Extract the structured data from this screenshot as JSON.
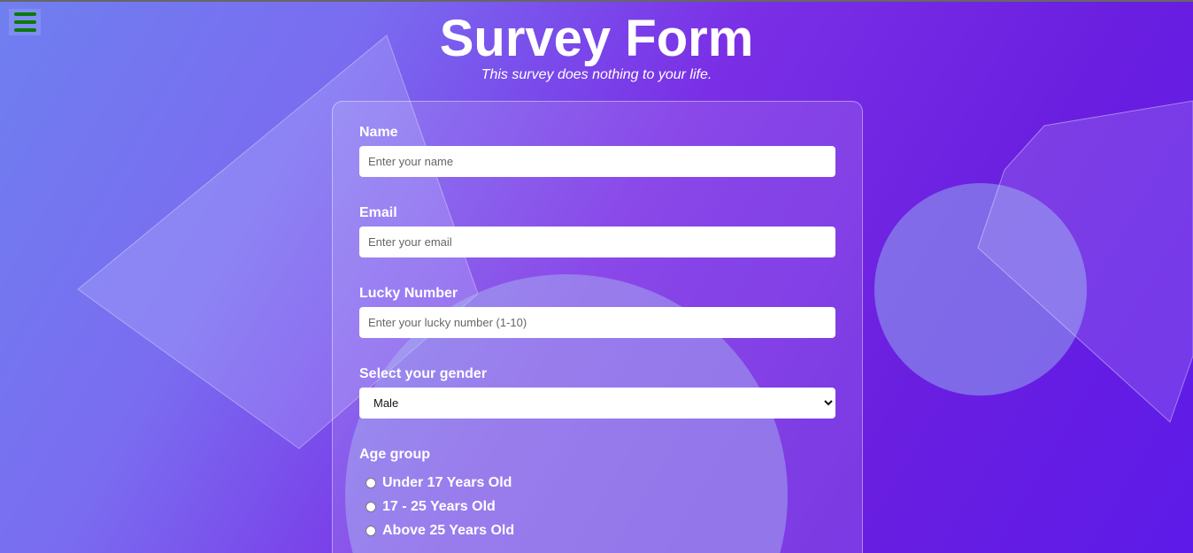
{
  "header": {
    "title": "Survey Form",
    "subtitle": "This survey does nothing to your life."
  },
  "menu": {
    "icon": "hamburger-icon",
    "color": "#0a7a0a"
  },
  "form": {
    "name": {
      "label": "Name",
      "placeholder": "Enter your name"
    },
    "email": {
      "label": "Email",
      "placeholder": "Enter your email"
    },
    "lucky": {
      "label": "Lucky Number",
      "placeholder": "Enter your lucky number (1-10)"
    },
    "gender": {
      "label": "Select your gender",
      "selected": "Male"
    },
    "age": {
      "label": "Age group",
      "options": [
        "Under 17 Years Old",
        "17 - 25 Years Old",
        "Above 25 Years Old"
      ]
    }
  }
}
